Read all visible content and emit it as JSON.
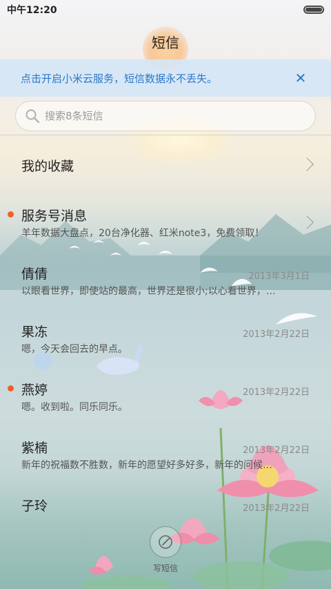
{
  "status_bar": {
    "time": "中午12:20",
    "battery_level": 1.0
  },
  "header": {
    "title": "短信"
  },
  "banner": {
    "text": "点击开启小米云服务，短信数据永不丢失。",
    "close_icon": "close-icon"
  },
  "search": {
    "placeholder": "搜索8条短信",
    "value": ""
  },
  "list": {
    "favorites": {
      "title": "我的收藏"
    },
    "service": {
      "title": "服务号消息",
      "preview": "羊年数据大盘点，20台净化器、红米note3，免费领取！",
      "unread": true
    },
    "items": [
      {
        "name": "倩倩",
        "preview": "以眼看世界，即使站的最高，世界还是很小;以心看世界，…",
        "date": "2013年3月1日",
        "unread": false
      },
      {
        "name": "果冻",
        "preview": "嗯，今天会回去的早点。",
        "date": "2013年2月22日",
        "unread": false
      },
      {
        "name": "燕婷",
        "preview": "嗯。收到啦。同乐同乐。",
        "date": "2013年2月22日",
        "unread": true
      },
      {
        "name": "紫楠",
        "preview": "新年的祝福数不胜数，新年的愿望好多好多，新年的问候…",
        "date": "2013年2月22日",
        "unread": false
      },
      {
        "name": "子玲",
        "preview": "",
        "date": "2013年2月22日",
        "unread": false
      }
    ]
  },
  "compose": {
    "label": "写短信",
    "icon": "pen-icon"
  },
  "colors": {
    "accent": "#2a78c9",
    "unread_dot": "#f2602c",
    "banner_bg": "#d6e6f6"
  }
}
